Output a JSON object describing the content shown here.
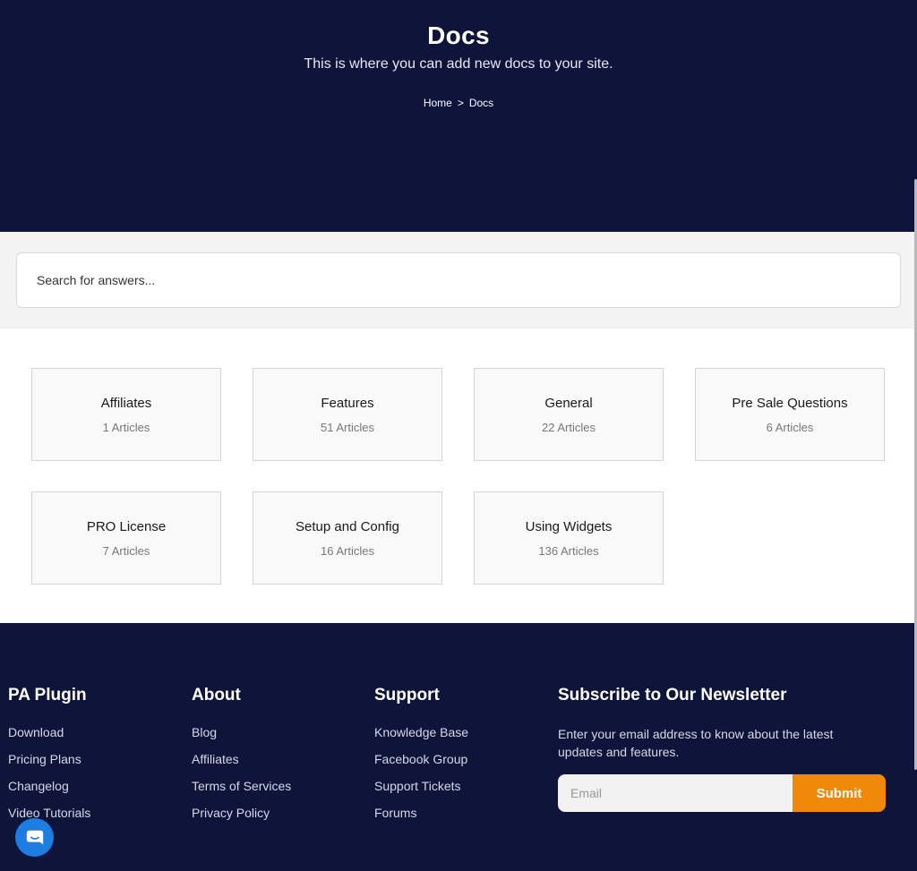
{
  "hero": {
    "title": "Docs",
    "subtitle": "This is where you can add new docs to your site.",
    "breadcrumb": {
      "home": "Home",
      "separator": ">",
      "current": "Docs"
    }
  },
  "search": {
    "placeholder": "Search for answers..."
  },
  "categories": [
    {
      "name": "Affiliates",
      "count": "1 Articles"
    },
    {
      "name": "Features",
      "count": "51 Articles"
    },
    {
      "name": "General",
      "count": "22 Articles"
    },
    {
      "name": "Pre Sale Questions",
      "count": "6 Articles"
    },
    {
      "name": "PRO License",
      "count": "7 Articles"
    },
    {
      "name": "Setup and Config",
      "count": "16 Articles"
    },
    {
      "name": "Using Widgets",
      "count": "136 Articles"
    }
  ],
  "footer": {
    "pa_plugin": {
      "heading": "PA Plugin",
      "links": [
        "Download",
        "Pricing Plans",
        "Changelog",
        "Video Tutorials"
      ]
    },
    "about": {
      "heading": "About",
      "links": [
        "Blog",
        "Affiliates",
        "Terms of Services",
        "Privacy Policy"
      ]
    },
    "support": {
      "heading": "Support",
      "links": [
        "Knowledge Base",
        "Facebook Group",
        "Support Tickets",
        "Forums"
      ]
    },
    "newsletter": {
      "heading": "Subscribe to Our Newsletter",
      "text": "Enter your email address to know about the latest updates and features.",
      "email_placeholder": "Email",
      "submit_label": "Submit"
    }
  },
  "chat": {
    "icon": "chat-bubble-icon"
  },
  "colors": {
    "navy": "#0f143b",
    "accent": "#f0890a",
    "chat": "#1e7de0"
  }
}
